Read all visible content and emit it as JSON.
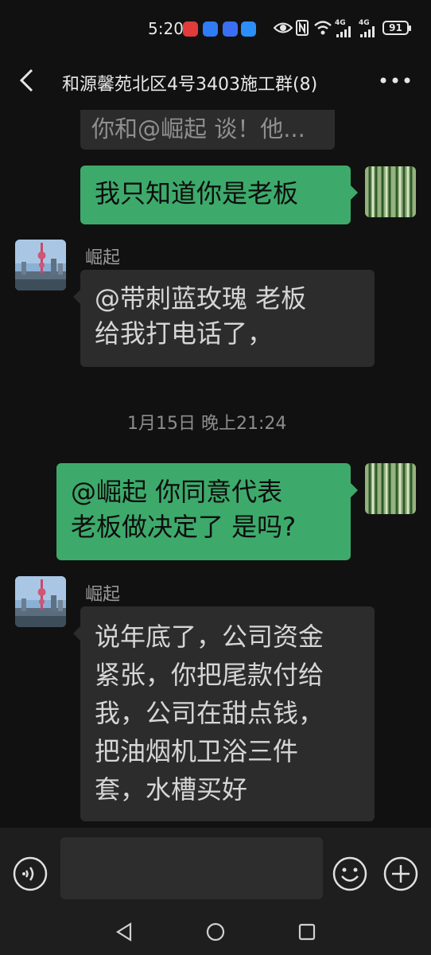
{
  "status_bar": {
    "time": "5:20",
    "signal_label_1": "4G",
    "signal_label_2": "4G",
    "battery": "91"
  },
  "header": {
    "title": "和源馨苑北区4号3403施工群(8)"
  },
  "messages": [
    {
      "side": "left",
      "text": "你和@崛起 谈！他..."
    },
    {
      "side": "right",
      "text": "我只知道你是老板"
    },
    {
      "side": "left",
      "sender": "崛起",
      "lines": [
        "@带刺蓝玫瑰  老板",
        "给我打电话了，"
      ]
    },
    {
      "type": "timestamp",
      "text": "1月15日 晚上21:24"
    },
    {
      "side": "right",
      "lines": [
        "@崛起  你同意代表",
        "老板做决定了 是吗?"
      ]
    },
    {
      "side": "left",
      "sender": "崛起",
      "lines": [
        "说年底了，公司资金",
        "紧张，你把尾款付给",
        "我，公司在甜点钱，",
        "把油烟机卫浴三件",
        "套，水槽买好"
      ]
    }
  ],
  "colors": {
    "background": "#111111",
    "bubble_self": "#3daa6b",
    "bubble_other": "#2c2c2c"
  }
}
